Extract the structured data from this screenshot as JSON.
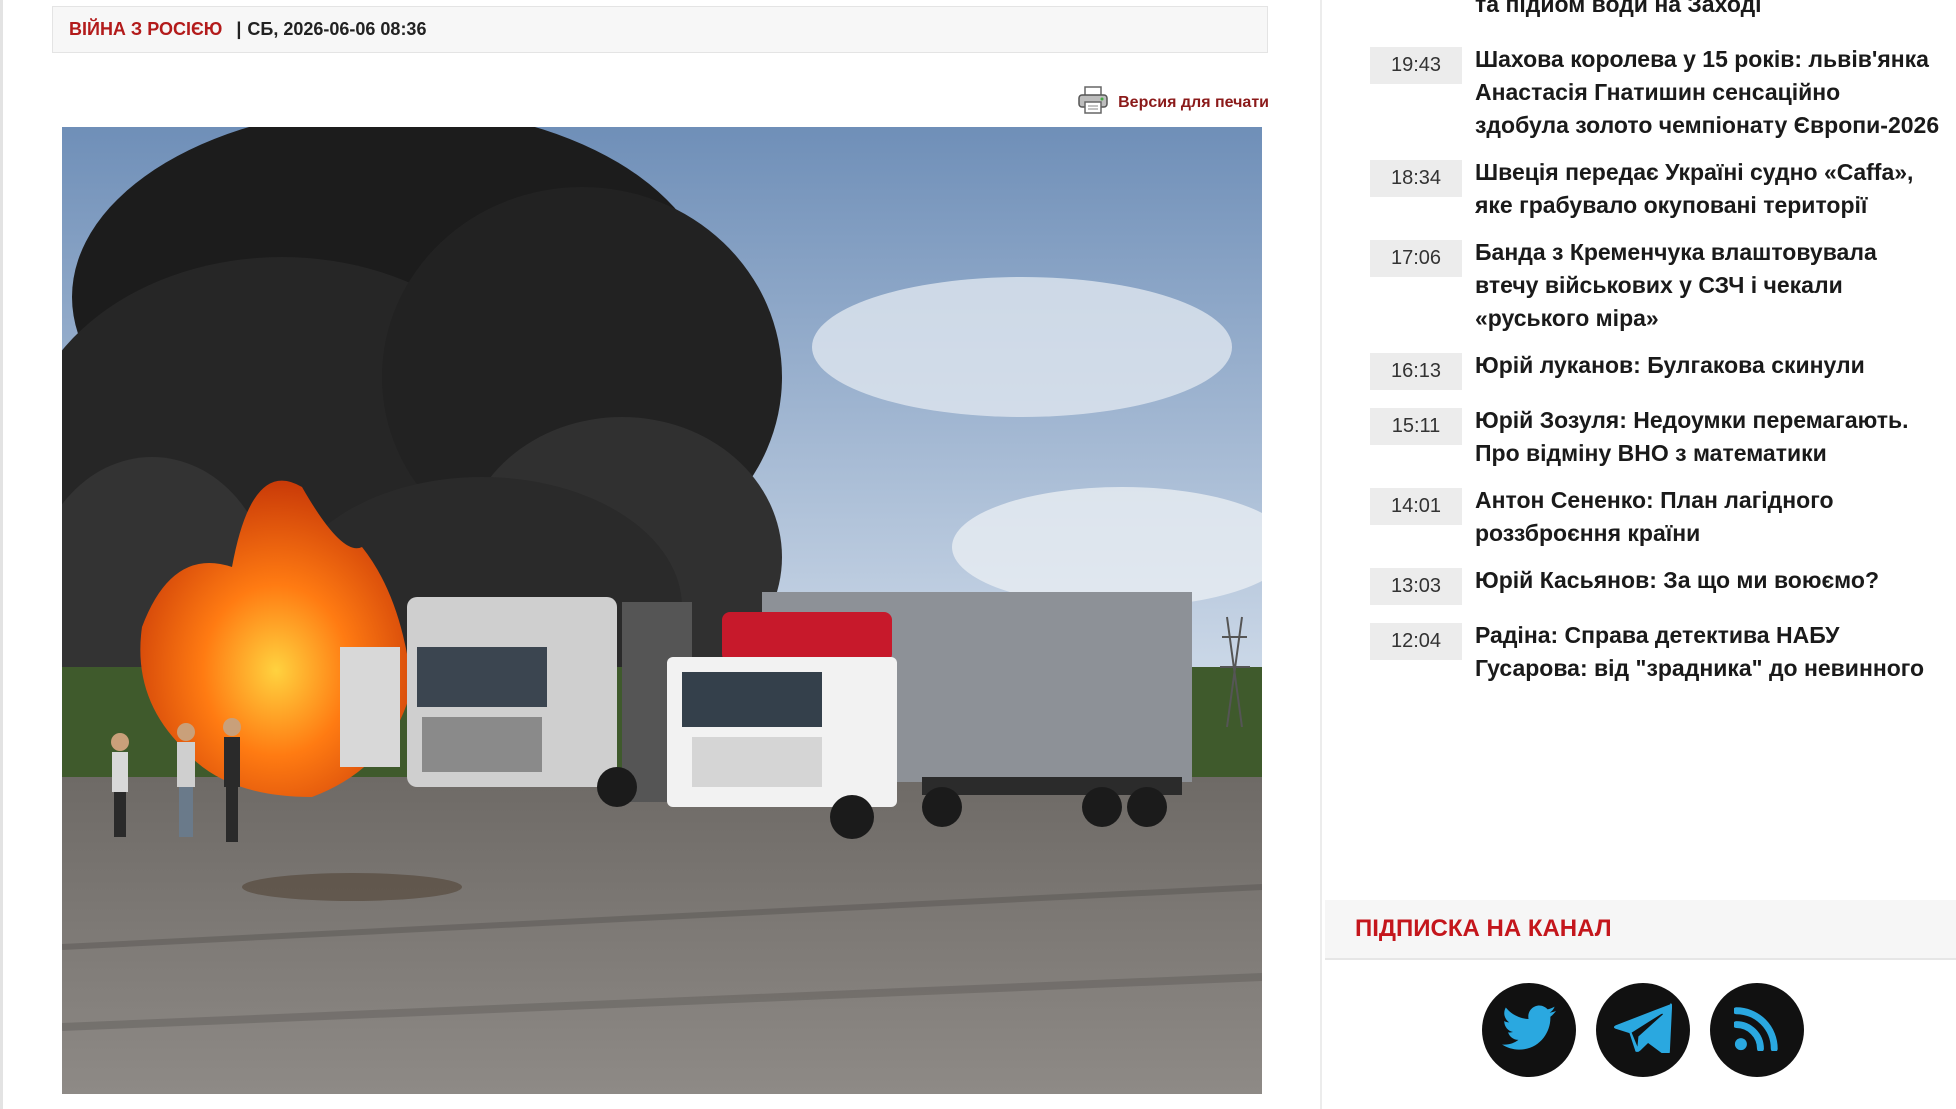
{
  "article": {
    "category": "ВІЙНА З РОСІЄЮ",
    "separator": "|",
    "date": "СБ, 2026-06-06 08:36",
    "print_label": "Версия для печати"
  },
  "sidebar": {
    "news": [
      {
        "time": "",
        "title": "та підйом води на Заході"
      },
      {
        "time": "19:43",
        "title": "Шахова королева у 15 років: львів'янка Анастасія Гнатишин сенсаційно здобула золото чемпіонату Європи-2026"
      },
      {
        "time": "18:34",
        "title": "Швеція передає Україні судно «Caffa», яке грабувало окуповані території"
      },
      {
        "time": "17:06",
        "title": "Банда з Кременчука влаштовувала втечу військових у СЗЧ і чекали «руського міра»"
      },
      {
        "time": "16:13",
        "title": "Юрій луканов: Булгакова скинули"
      },
      {
        "time": "15:11",
        "title": "Юрій Зозуля: Недоумки перемагають. Про відміну ВНО з математики"
      },
      {
        "time": "14:01",
        "title": "Антон Сененко: План лагідного роззброєння країни"
      },
      {
        "time": "13:03",
        "title": "Юрій Касьянов: За що ми воюємо?"
      },
      {
        "time": "12:04",
        "title": "Радіна: Справа детектива НАБУ Гусарова: від \"зрадника\" до невинного"
      }
    ],
    "subscribe_title": "ПІДПИСКА НА КАНАЛ",
    "social": [
      {
        "icon": "twitter-icon"
      },
      {
        "icon": "telegram-icon"
      },
      {
        "icon": "rss-icon"
      }
    ]
  },
  "colors": {
    "accent_red": "#c4161c",
    "category_red": "#b31b1b"
  }
}
